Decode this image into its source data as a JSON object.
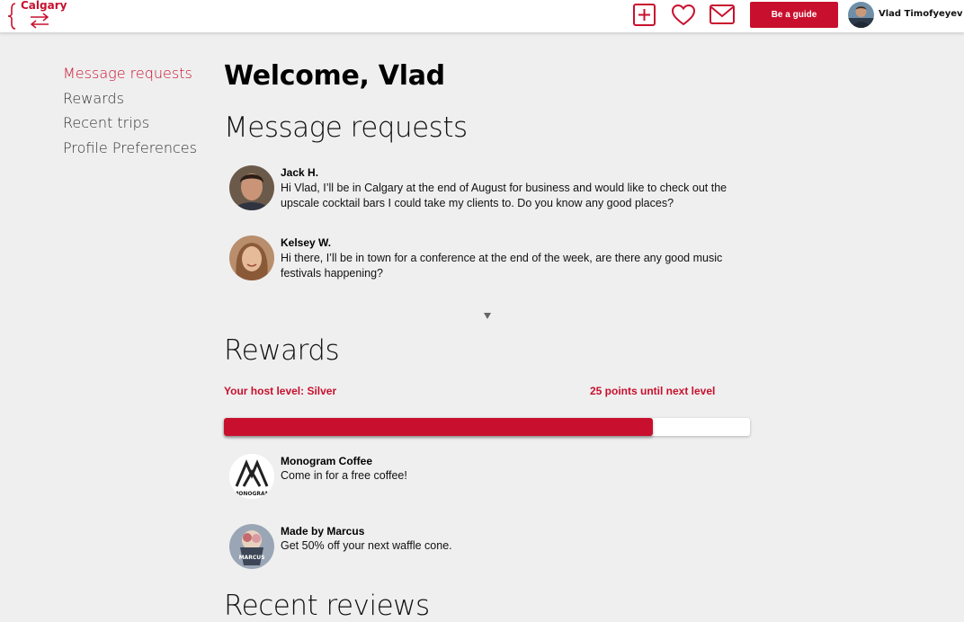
{
  "header": {
    "logo_text": "Calgary",
    "be_guide_label": "Be a guide",
    "user_name": "Vlad Timofyeyev",
    "brand_color": "#c8102e",
    "icons": [
      "add-icon",
      "heart-icon",
      "mail-icon"
    ]
  },
  "sidebar": {
    "items": [
      {
        "label": "Message requests",
        "active": true
      },
      {
        "label": "Rewards",
        "active": false
      },
      {
        "label": "Recent trips",
        "active": false
      },
      {
        "label": "Profile Preferences",
        "active": false
      }
    ]
  },
  "main": {
    "welcome": "Welcome, Vlad",
    "messages_title": "Message requests",
    "messages": [
      {
        "name": "Jack H.",
        "text": "Hi Vlad, I’ll be in Calgary at the end of August for business and would like to check out the upscale cocktail bars I could take my clients to.  Do you know any good places?"
      },
      {
        "name": "Kelsey W.",
        "text": "Hi there, I’ll be in town for a conference at the end of the week, are there any good music festivals happening?"
      }
    ],
    "rewards_title": "Rewards",
    "host_level": "Your host level: Silver",
    "points_until_next": "25 points until next level",
    "progress_fraction": 0.815,
    "rewards": [
      {
        "name": "Monogram Coffee",
        "text": "Come in for a free coffee!",
        "logo_text": "MONOGRAM"
      },
      {
        "name": "Made by Marcus",
        "text": "Get 50% off your next waffle cone.",
        "logo_text": "MARCUS"
      }
    ],
    "reviews_title": "Recent reviews"
  }
}
